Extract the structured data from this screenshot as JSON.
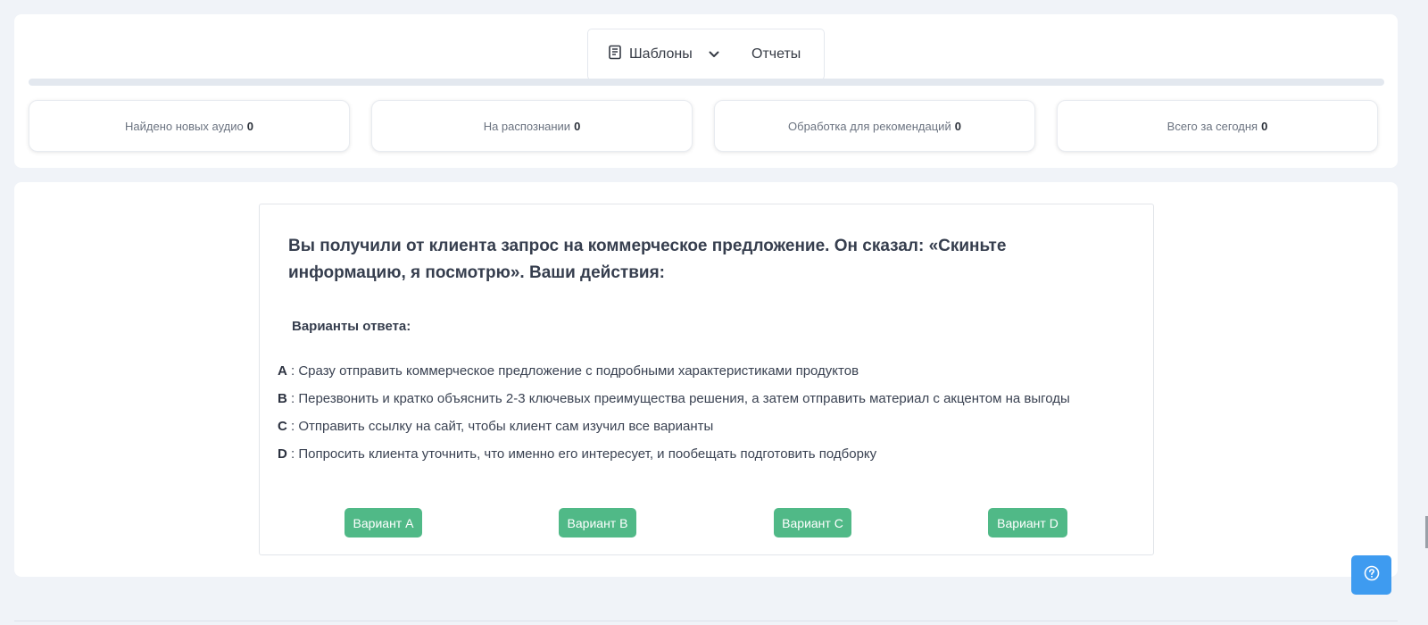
{
  "nav": {
    "templates_label": "Шаблоны",
    "reports_label": "Отчеты"
  },
  "progress": {
    "percent": 0
  },
  "stats": [
    {
      "label": "Найдено новых аудио",
      "value": "0"
    },
    {
      "label": "На распознании",
      "value": "0"
    },
    {
      "label": "Обработка для рекомендаций",
      "value": "0"
    },
    {
      "label": "Всего за сегодня",
      "value": "0"
    }
  ],
  "quiz": {
    "question": "Вы получили от клиента запрос на коммерческое предложение. Он сказал: «Скиньте информацию, я посмотрю». Ваши действия:",
    "answers_title": "Варианты ответа:",
    "options": [
      {
        "letter": "A",
        "text": " : Сразу отправить коммерческое предложение с подробными характеристиками продуктов"
      },
      {
        "letter": "B",
        "text": " : Перезвонить и кратко объяснить 2-3 ключевых преимущества решения, а затем отправить материал с акцентом на выгоды"
      },
      {
        "letter": "C",
        "text": " : Отправить ссылку на сайт, чтобы клиент сам изучил все варианты"
      },
      {
        "letter": "D",
        "text": " : Попросить клиента уточнить, что именно его интересует, и пообещать подготовить подборку"
      }
    ],
    "buttons": [
      "Вариант A",
      "Вариант B",
      "Вариант C",
      "Вариант D"
    ]
  },
  "colors": {
    "accent_green": "#50b987",
    "help_blue": "#3e9bf0"
  },
  "icons": {
    "templates": "book-icon",
    "dropdown": "chevron-down-icon",
    "help": "help-circle-icon"
  }
}
